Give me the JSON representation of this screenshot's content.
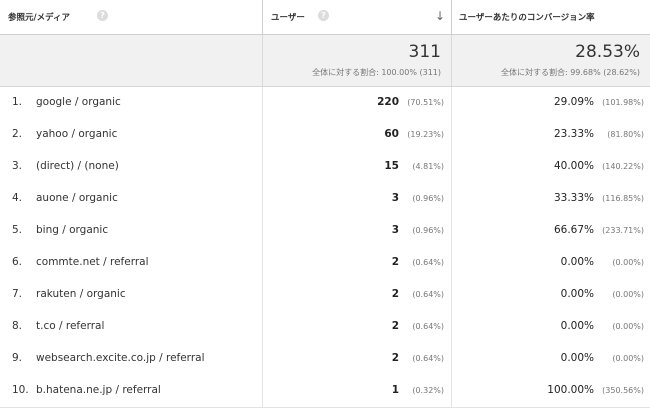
{
  "header": {
    "col_source": "参照元/メディア",
    "col_users": "ユーザー",
    "col_conv": "ユーザーあたりのコンバージョン率",
    "help_glyph": "?",
    "sort_glyph": "↓"
  },
  "totals": {
    "users": "311",
    "users_sub": "全体に対する割合: 100.00% (311)",
    "conv": "28.53%",
    "conv_sub": "全体に対する割合: 99.68% (28.62%)"
  },
  "rows": [
    {
      "idx": "1.",
      "source": "google / organic",
      "users": "220",
      "users_pct": "(70.51%)",
      "conv": "29.09%",
      "conv_pct": "(101.98%)"
    },
    {
      "idx": "2.",
      "source": "yahoo / organic",
      "users": "60",
      "users_pct": "(19.23%)",
      "conv": "23.33%",
      "conv_pct": "(81.80%)"
    },
    {
      "idx": "3.",
      "source": "(direct) / (none)",
      "users": "15",
      "users_pct": "(4.81%)",
      "conv": "40.00%",
      "conv_pct": "(140.22%)"
    },
    {
      "idx": "4.",
      "source": "auone / organic",
      "users": "3",
      "users_pct": "(0.96%)",
      "conv": "33.33%",
      "conv_pct": "(116.85%)"
    },
    {
      "idx": "5.",
      "source": "bing / organic",
      "users": "3",
      "users_pct": "(0.96%)",
      "conv": "66.67%",
      "conv_pct": "(233.71%)"
    },
    {
      "idx": "6.",
      "source": "commte.net / referral",
      "users": "2",
      "users_pct": "(0.64%)",
      "conv": "0.00%",
      "conv_pct": "(0.00%)"
    },
    {
      "idx": "7.",
      "source": "rakuten / organic",
      "users": "2",
      "users_pct": "(0.64%)",
      "conv": "0.00%",
      "conv_pct": "(0.00%)"
    },
    {
      "idx": "8.",
      "source": "t.co / referral",
      "users": "2",
      "users_pct": "(0.64%)",
      "conv": "0.00%",
      "conv_pct": "(0.00%)"
    },
    {
      "idx": "9.",
      "source": "websearch.excite.co.jp / referral",
      "users": "2",
      "users_pct": "(0.64%)",
      "conv": "0.00%",
      "conv_pct": "(0.00%)"
    },
    {
      "idx": "10.",
      "source": "b.hatena.ne.jp / referral",
      "users": "1",
      "users_pct": "(0.32%)",
      "conv": "100.00%",
      "conv_pct": "(350.56%)"
    }
  ]
}
